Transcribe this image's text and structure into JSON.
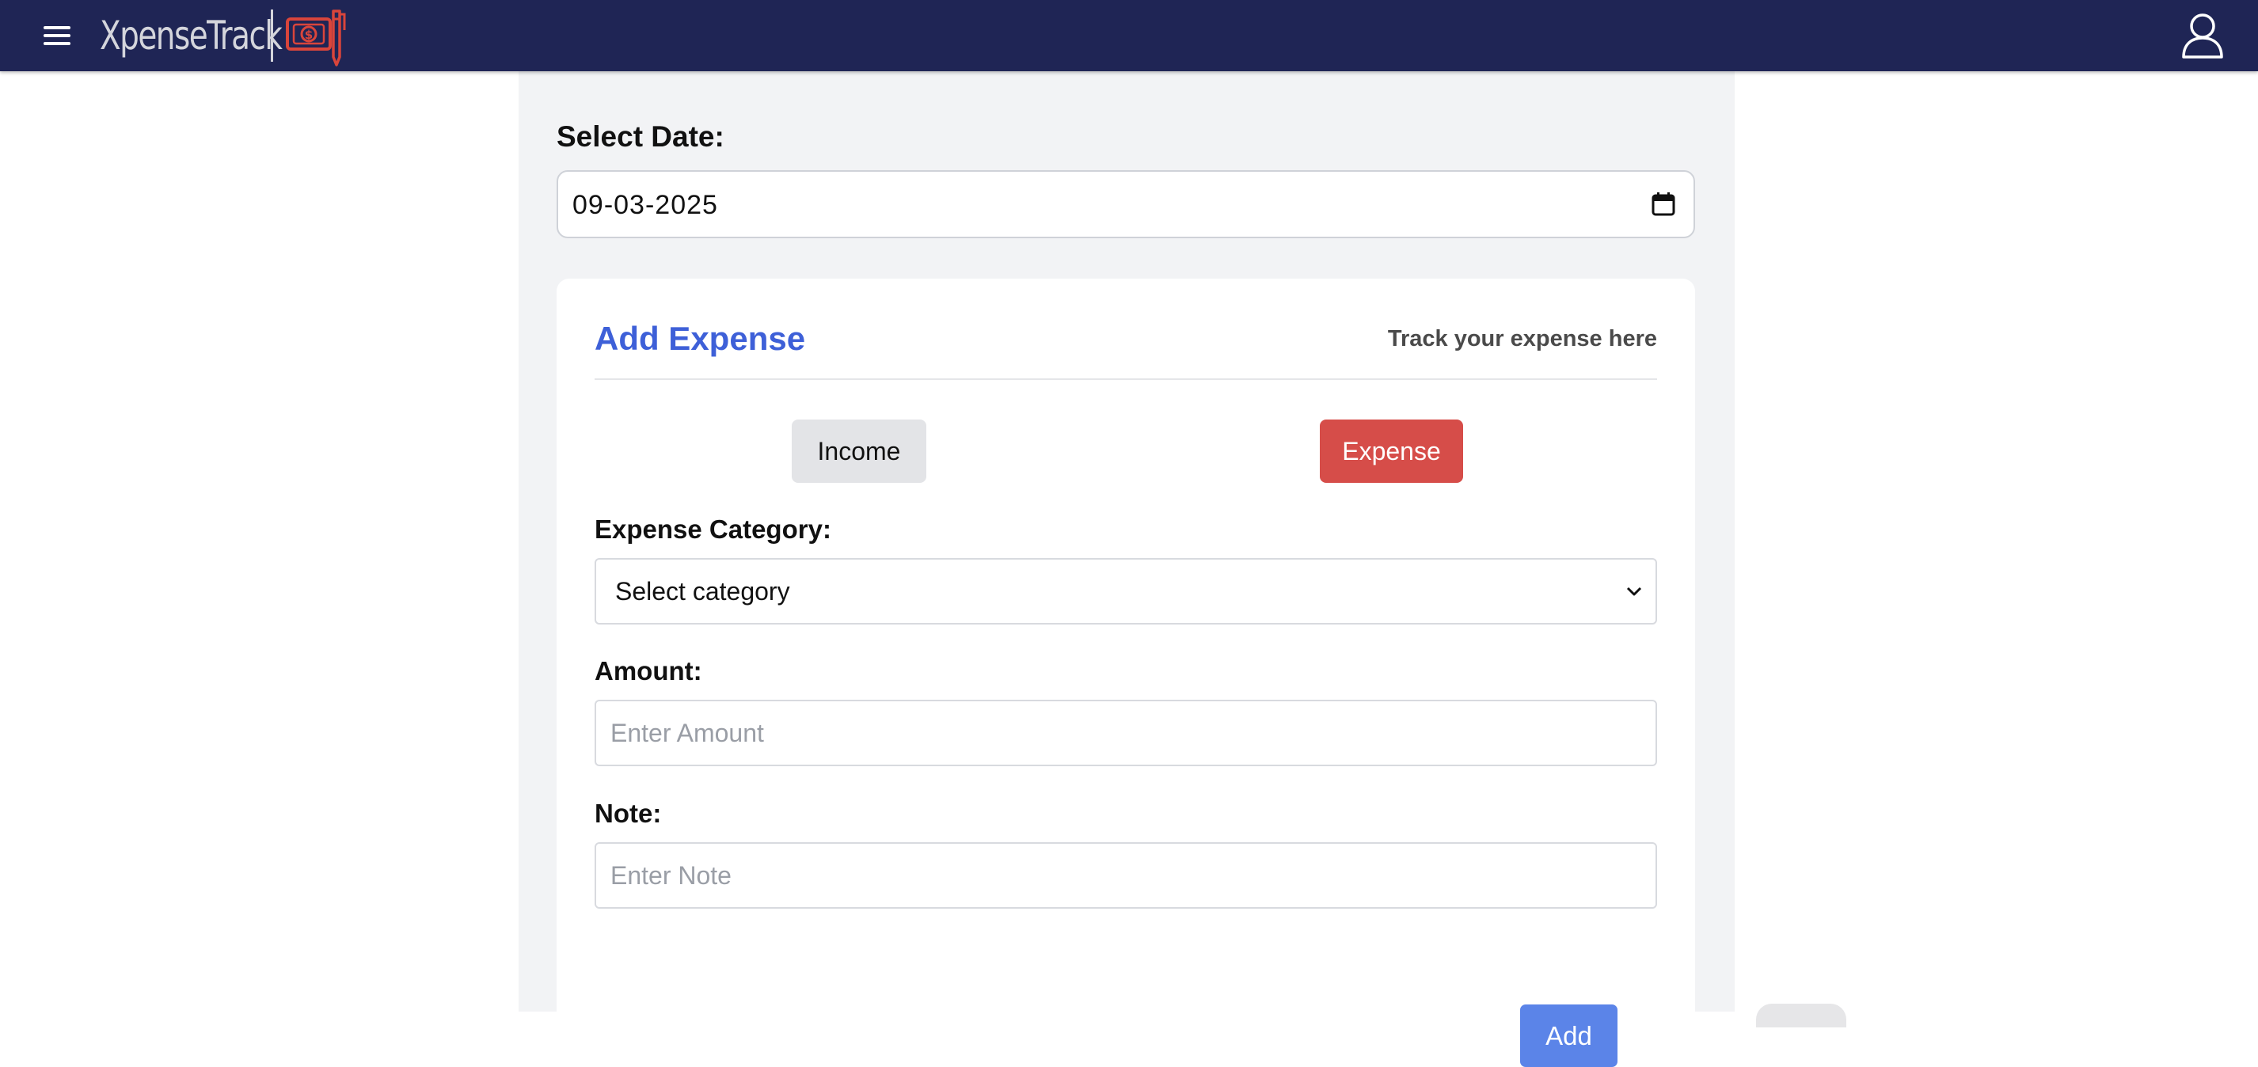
{
  "header": {
    "menu_icon": "hamburger-menu-icon",
    "logo_text": "XpenseTrack",
    "logo_mark_icon": "money-bill-pen-icon",
    "user_icon": "user-profile-icon",
    "colors": {
      "background": "#1f2555",
      "logo": "#d4d5dc",
      "logo_mark": "#d9453b"
    }
  },
  "date_picker": {
    "label": "Select Date:",
    "value": "09-03-2025",
    "icon": "calendar-icon"
  },
  "card": {
    "title": "Add Expense",
    "subtitle": "Track your expense here",
    "toggle": {
      "income_label": "Income",
      "expense_label": "Expense",
      "selected": "Expense"
    },
    "category": {
      "label": "Expense Category:",
      "selected": "Select category",
      "icon": "chevron-down-icon"
    },
    "amount": {
      "label": "Amount:",
      "placeholder": "Enter Amount",
      "value": ""
    },
    "note": {
      "label": "Note:",
      "placeholder": "Enter Note",
      "value": ""
    },
    "submit_label": "Add"
  },
  "colors": {
    "accent": "#3e60d8",
    "expense_active": "#d64d49",
    "add_button": "#5b84e8",
    "panel_background": "#f2f3f5"
  }
}
